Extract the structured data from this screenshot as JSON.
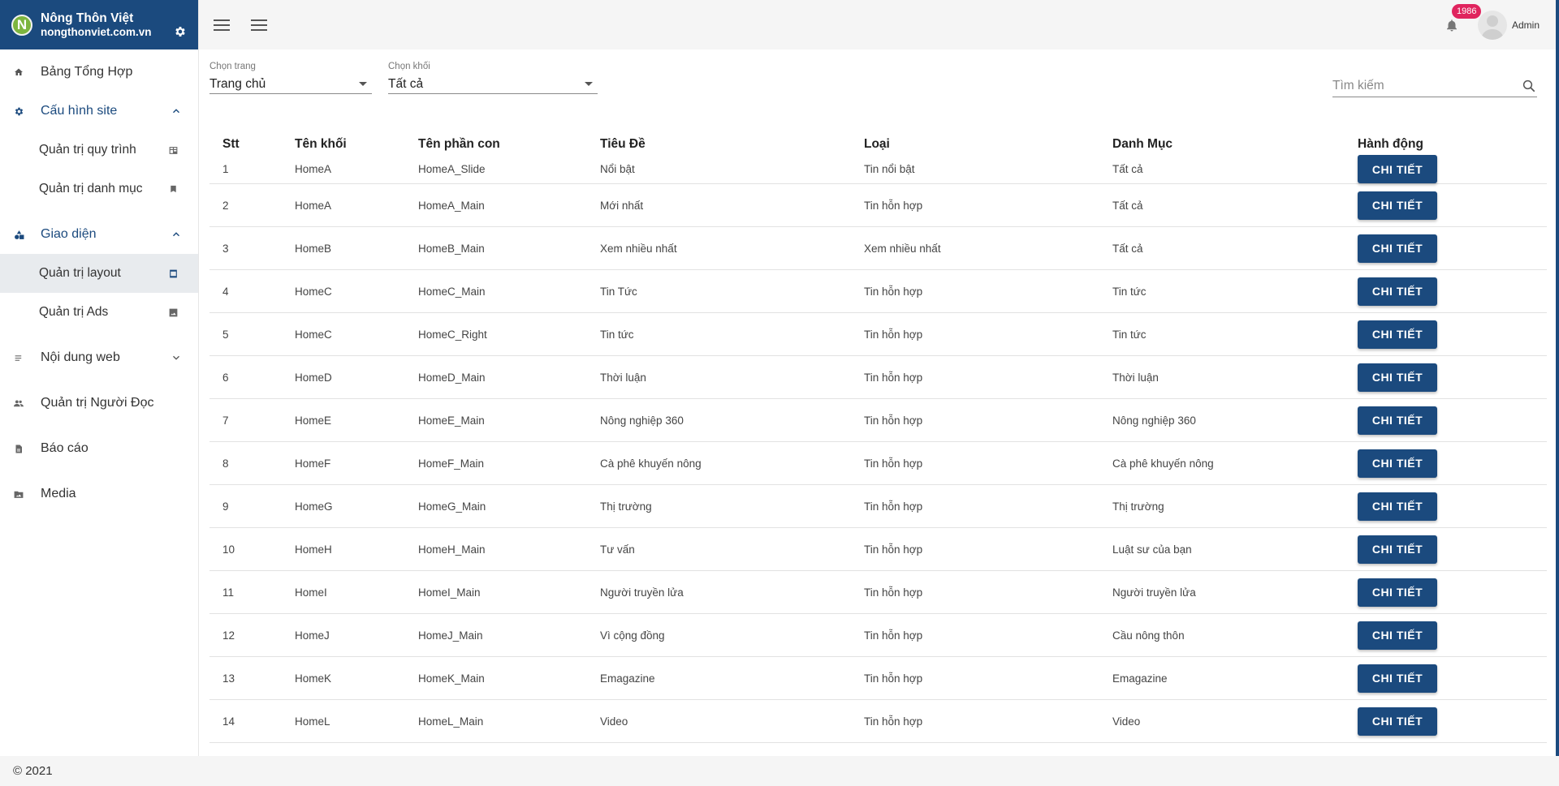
{
  "brand": {
    "logo_letter": "N",
    "name": "Nông Thôn Việt",
    "domain": "nongthonviet.com.vn"
  },
  "sidebar": {
    "items": [
      {
        "label": "Bảng Tổng Hợp",
        "icon": "home-icon"
      },
      {
        "label": "Cấu hình site",
        "icon": "gear-icon",
        "expanded": true,
        "children": [
          {
            "label": "Quản trị quy trình",
            "icon": "workflow-icon"
          },
          {
            "label": "Quản trị danh mục",
            "icon": "bookmark-icon"
          }
        ]
      },
      {
        "label": "Giao diện",
        "icon": "shapes-icon",
        "expanded": true,
        "children": [
          {
            "label": "Quản trị layout",
            "icon": "layout-icon",
            "active": true
          },
          {
            "label": "Quản trị Ads",
            "icon": "image-icon"
          }
        ]
      },
      {
        "label": "Nội dung web",
        "icon": "list-icon",
        "expanded": false
      },
      {
        "label": "Quản trị Người Đọc",
        "icon": "people-icon"
      },
      {
        "label": "Báo cáo",
        "icon": "report-icon"
      },
      {
        "label": "Media",
        "icon": "media-icon"
      }
    ]
  },
  "header": {
    "notification_count": "1986",
    "user_name": "Admin"
  },
  "filters": {
    "page": {
      "label": "Chọn trang",
      "value": "Trang chủ"
    },
    "block": {
      "label": "Chọn khối",
      "value": "Tất cả"
    },
    "search_placeholder": "Tìm kiếm"
  },
  "table": {
    "headers": [
      "Stt",
      "Tên khối",
      "Tên phần con",
      "Tiêu Đề",
      "Loại",
      "Danh Mục",
      "Hành động"
    ],
    "action_label": "CHI TIẾT",
    "rows": [
      [
        "1",
        "HomeA",
        "HomeA_Slide",
        "Nổi bật",
        "Tin nổi bật",
        "Tất cả"
      ],
      [
        "2",
        "HomeA",
        "HomeA_Main",
        "Mới nhất",
        "Tin hỗn hợp",
        "Tất cả"
      ],
      [
        "3",
        "HomeB",
        "HomeB_Main",
        "Xem nhiều nhất",
        "Xem nhiều nhất",
        "Tất cả"
      ],
      [
        "4",
        "HomeC",
        "HomeC_Main",
        "Tin Tức",
        "Tin hỗn hợp",
        "Tin tức"
      ],
      [
        "5",
        "HomeC",
        "HomeC_Right",
        "Tin tức",
        "Tin hỗn hợp",
        "Tin tức"
      ],
      [
        "6",
        "HomeD",
        "HomeD_Main",
        "Thời luận",
        "Tin hỗn hợp",
        "Thời luận"
      ],
      [
        "7",
        "HomeE",
        "HomeE_Main",
        "Nông nghiệp 360",
        "Tin hỗn hợp",
        "Nông nghiệp 360"
      ],
      [
        "8",
        "HomeF",
        "HomeF_Main",
        "Cà phê khuyến nông",
        "Tin hỗn hợp",
        "Cà phê khuyến nông"
      ],
      [
        "9",
        "HomeG",
        "HomeG_Main",
        "Thị trường",
        "Tin hỗn hợp",
        "Thị trường"
      ],
      [
        "10",
        "HomeH",
        "HomeH_Main",
        "Tư vấn",
        "Tin hỗn hợp",
        "Luật sư của bạn"
      ],
      [
        "11",
        "HomeI",
        "HomeI_Main",
        "Người truyền lửa",
        "Tin hỗn hợp",
        "Người truyền lửa"
      ],
      [
        "12",
        "HomeJ",
        "HomeJ_Main",
        "Vì cộng đồng",
        "Tin hỗn hợp",
        "Cầu nông thôn"
      ],
      [
        "13",
        "HomeK",
        "HomeK_Main",
        "Emagazine",
        "Tin hỗn hợp",
        "Emagazine"
      ],
      [
        "14",
        "HomeL",
        "HomeL_Main",
        "Video",
        "Tin hỗn hợp",
        "Video"
      ]
    ]
  },
  "footer": {
    "text": "© 2021"
  },
  "colors": {
    "primary": "#1b4a7e",
    "badge": "#e0245e",
    "logo": "#7db53f"
  }
}
